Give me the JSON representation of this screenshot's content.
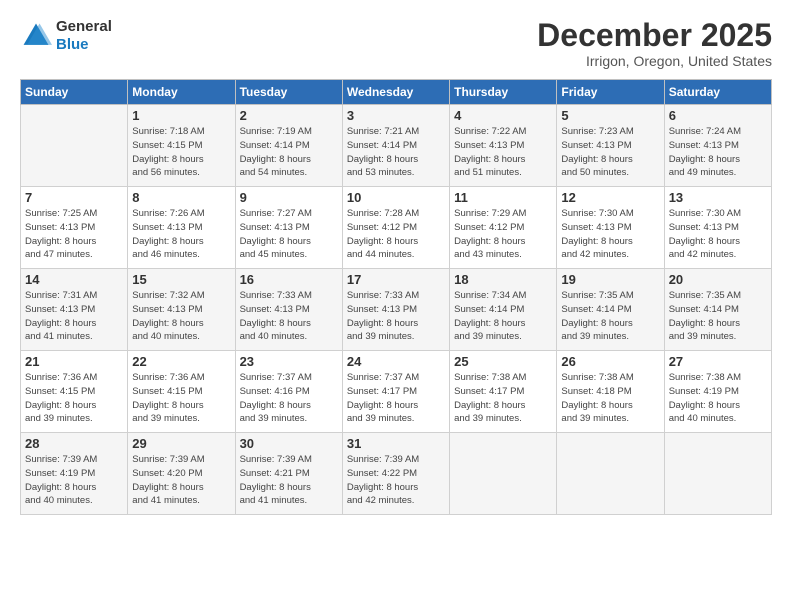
{
  "header": {
    "logo_line1": "General",
    "logo_line2": "Blue",
    "month": "December 2025",
    "location": "Irrigon, Oregon, United States"
  },
  "days_of_week": [
    "Sunday",
    "Monday",
    "Tuesday",
    "Wednesday",
    "Thursday",
    "Friday",
    "Saturday"
  ],
  "weeks": [
    [
      {
        "day": "",
        "info": ""
      },
      {
        "day": "1",
        "info": "Sunrise: 7:18 AM\nSunset: 4:15 PM\nDaylight: 8 hours\nand 56 minutes."
      },
      {
        "day": "2",
        "info": "Sunrise: 7:19 AM\nSunset: 4:14 PM\nDaylight: 8 hours\nand 54 minutes."
      },
      {
        "day": "3",
        "info": "Sunrise: 7:21 AM\nSunset: 4:14 PM\nDaylight: 8 hours\nand 53 minutes."
      },
      {
        "day": "4",
        "info": "Sunrise: 7:22 AM\nSunset: 4:13 PM\nDaylight: 8 hours\nand 51 minutes."
      },
      {
        "day": "5",
        "info": "Sunrise: 7:23 AM\nSunset: 4:13 PM\nDaylight: 8 hours\nand 50 minutes."
      },
      {
        "day": "6",
        "info": "Sunrise: 7:24 AM\nSunset: 4:13 PM\nDaylight: 8 hours\nand 49 minutes."
      }
    ],
    [
      {
        "day": "7",
        "info": "Sunrise: 7:25 AM\nSunset: 4:13 PM\nDaylight: 8 hours\nand 47 minutes."
      },
      {
        "day": "8",
        "info": "Sunrise: 7:26 AM\nSunset: 4:13 PM\nDaylight: 8 hours\nand 46 minutes."
      },
      {
        "day": "9",
        "info": "Sunrise: 7:27 AM\nSunset: 4:13 PM\nDaylight: 8 hours\nand 45 minutes."
      },
      {
        "day": "10",
        "info": "Sunrise: 7:28 AM\nSunset: 4:12 PM\nDaylight: 8 hours\nand 44 minutes."
      },
      {
        "day": "11",
        "info": "Sunrise: 7:29 AM\nSunset: 4:12 PM\nDaylight: 8 hours\nand 43 minutes."
      },
      {
        "day": "12",
        "info": "Sunrise: 7:30 AM\nSunset: 4:13 PM\nDaylight: 8 hours\nand 42 minutes."
      },
      {
        "day": "13",
        "info": "Sunrise: 7:30 AM\nSunset: 4:13 PM\nDaylight: 8 hours\nand 42 minutes."
      }
    ],
    [
      {
        "day": "14",
        "info": "Sunrise: 7:31 AM\nSunset: 4:13 PM\nDaylight: 8 hours\nand 41 minutes."
      },
      {
        "day": "15",
        "info": "Sunrise: 7:32 AM\nSunset: 4:13 PM\nDaylight: 8 hours\nand 40 minutes."
      },
      {
        "day": "16",
        "info": "Sunrise: 7:33 AM\nSunset: 4:13 PM\nDaylight: 8 hours\nand 40 minutes."
      },
      {
        "day": "17",
        "info": "Sunrise: 7:33 AM\nSunset: 4:13 PM\nDaylight: 8 hours\nand 39 minutes."
      },
      {
        "day": "18",
        "info": "Sunrise: 7:34 AM\nSunset: 4:14 PM\nDaylight: 8 hours\nand 39 minutes."
      },
      {
        "day": "19",
        "info": "Sunrise: 7:35 AM\nSunset: 4:14 PM\nDaylight: 8 hours\nand 39 minutes."
      },
      {
        "day": "20",
        "info": "Sunrise: 7:35 AM\nSunset: 4:14 PM\nDaylight: 8 hours\nand 39 minutes."
      }
    ],
    [
      {
        "day": "21",
        "info": "Sunrise: 7:36 AM\nSunset: 4:15 PM\nDaylight: 8 hours\nand 39 minutes."
      },
      {
        "day": "22",
        "info": "Sunrise: 7:36 AM\nSunset: 4:15 PM\nDaylight: 8 hours\nand 39 minutes."
      },
      {
        "day": "23",
        "info": "Sunrise: 7:37 AM\nSunset: 4:16 PM\nDaylight: 8 hours\nand 39 minutes."
      },
      {
        "day": "24",
        "info": "Sunrise: 7:37 AM\nSunset: 4:17 PM\nDaylight: 8 hours\nand 39 minutes."
      },
      {
        "day": "25",
        "info": "Sunrise: 7:38 AM\nSunset: 4:17 PM\nDaylight: 8 hours\nand 39 minutes."
      },
      {
        "day": "26",
        "info": "Sunrise: 7:38 AM\nSunset: 4:18 PM\nDaylight: 8 hours\nand 39 minutes."
      },
      {
        "day": "27",
        "info": "Sunrise: 7:38 AM\nSunset: 4:19 PM\nDaylight: 8 hours\nand 40 minutes."
      }
    ],
    [
      {
        "day": "28",
        "info": "Sunrise: 7:39 AM\nSunset: 4:19 PM\nDaylight: 8 hours\nand 40 minutes."
      },
      {
        "day": "29",
        "info": "Sunrise: 7:39 AM\nSunset: 4:20 PM\nDaylight: 8 hours\nand 41 minutes."
      },
      {
        "day": "30",
        "info": "Sunrise: 7:39 AM\nSunset: 4:21 PM\nDaylight: 8 hours\nand 41 minutes."
      },
      {
        "day": "31",
        "info": "Sunrise: 7:39 AM\nSunset: 4:22 PM\nDaylight: 8 hours\nand 42 minutes."
      },
      {
        "day": "",
        "info": ""
      },
      {
        "day": "",
        "info": ""
      },
      {
        "day": "",
        "info": ""
      }
    ]
  ]
}
